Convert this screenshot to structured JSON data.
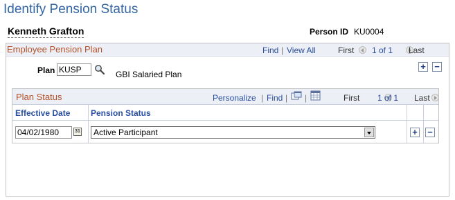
{
  "page": {
    "title": "Identify Pension Status"
  },
  "person": {
    "name": "Kenneth Grafton",
    "id_label": "Person ID",
    "id_value": "KU0004"
  },
  "pension_plan": {
    "section_title": "Employee Pension Plan",
    "find": "Find",
    "view_all": "View All",
    "first": "First",
    "count": "1 of 1",
    "last": "Last",
    "plan_label": "Plan",
    "plan_value": "KUSP",
    "plan_description": "GBI Salaried Plan"
  },
  "plan_status": {
    "section_title": "Plan Status",
    "personalize": "Personalize",
    "find": "Find",
    "first": "First",
    "count": "1 of 1",
    "last": "Last",
    "columns": [
      "Effective Date",
      "Pension Status"
    ],
    "rows": [
      {
        "effective_date": "04/02/1980",
        "pension_status": "Active Participant"
      }
    ]
  },
  "icons": {
    "lookup": "magnifier-icon",
    "calendar": "calendar-icon",
    "view_in_window": "new-window-icon",
    "download": "grid-download-icon",
    "add": "plus-icon",
    "delete": "minus-icon"
  },
  "buttons": {
    "add_symbol": "+",
    "delete_symbol": "−",
    "calendar_glyph": "31"
  },
  "colors": {
    "title": "#3366a3",
    "section_title": "#b5522b",
    "link": "#2a4f9e",
    "header_bg": "#eceff5"
  }
}
